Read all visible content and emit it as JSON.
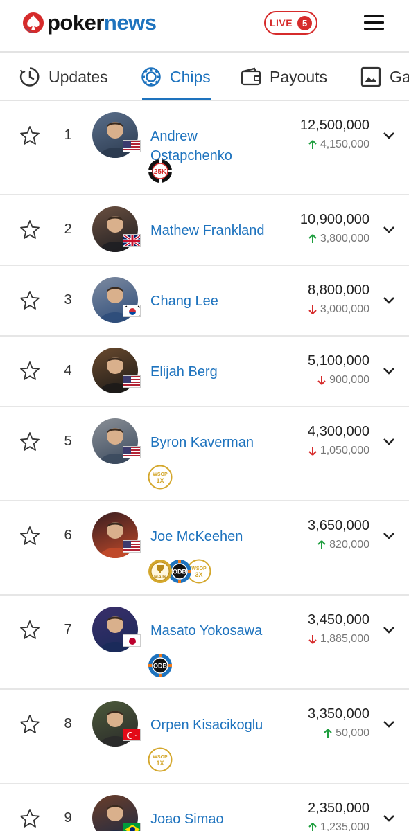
{
  "header": {
    "brand_part1": "poker",
    "brand_part2": "news",
    "live_label": "LIVE",
    "live_count": "5"
  },
  "tabs": [
    {
      "label": "Updates",
      "icon": "clock-icon"
    },
    {
      "label": "Chips",
      "icon": "poker-chip-icon",
      "active": true
    },
    {
      "label": "Payouts",
      "icon": "wallet-icon"
    },
    {
      "label": "Ga",
      "icon": "image-icon"
    }
  ],
  "players": [
    {
      "rank": "1",
      "name": "Andrew Ostapchenko",
      "chips": "12,500,000",
      "change": "4,150,000",
      "direction": "up",
      "flag": "USA",
      "badges": [
        "25K"
      ]
    },
    {
      "rank": "2",
      "name": "Mathew Frankland",
      "chips": "10,900,000",
      "change": "3,800,000",
      "direction": "up",
      "flag": "UK",
      "badges": []
    },
    {
      "rank": "3",
      "name": "Chang Lee",
      "chips": "8,800,000",
      "change": "3,000,000",
      "direction": "down",
      "flag": "KOR",
      "badges": []
    },
    {
      "rank": "4",
      "name": "Elijah Berg",
      "chips": "5,100,000",
      "change": "900,000",
      "direction": "down",
      "flag": "USA",
      "badges": []
    },
    {
      "rank": "5",
      "name": "Byron Kaverman",
      "chips": "4,300,000",
      "change": "1,050,000",
      "direction": "down",
      "flag": "USA",
      "badges": [
        "WSOP 1X"
      ]
    },
    {
      "rank": "6",
      "name": "Joe McKeehen",
      "chips": "3,650,000",
      "change": "820,000",
      "direction": "up",
      "flag": "USA",
      "badges": [
        "MAIN",
        "ODB",
        "WSOP 3X"
      ]
    },
    {
      "rank": "7",
      "name": "Masato Yokosawa",
      "chips": "3,450,000",
      "change": "1,885,000",
      "direction": "down",
      "flag": "JPN",
      "badges": [
        "ODB"
      ]
    },
    {
      "rank": "8",
      "name": "Orpen Kisacikoglu",
      "chips": "3,350,000",
      "change": "50,000",
      "direction": "up",
      "flag": "TUR",
      "badges": [
        "WSOP 1X"
      ]
    },
    {
      "rank": "9",
      "name": "Joao Simao",
      "chips": "2,350,000",
      "change": "1,235,000",
      "direction": "up",
      "flag": "BRA",
      "badges": []
    }
  ],
  "colors": {
    "accent": "#1e73be",
    "live": "#d62b2b",
    "up": "#1e9e3e",
    "down": "#d62b2b"
  }
}
